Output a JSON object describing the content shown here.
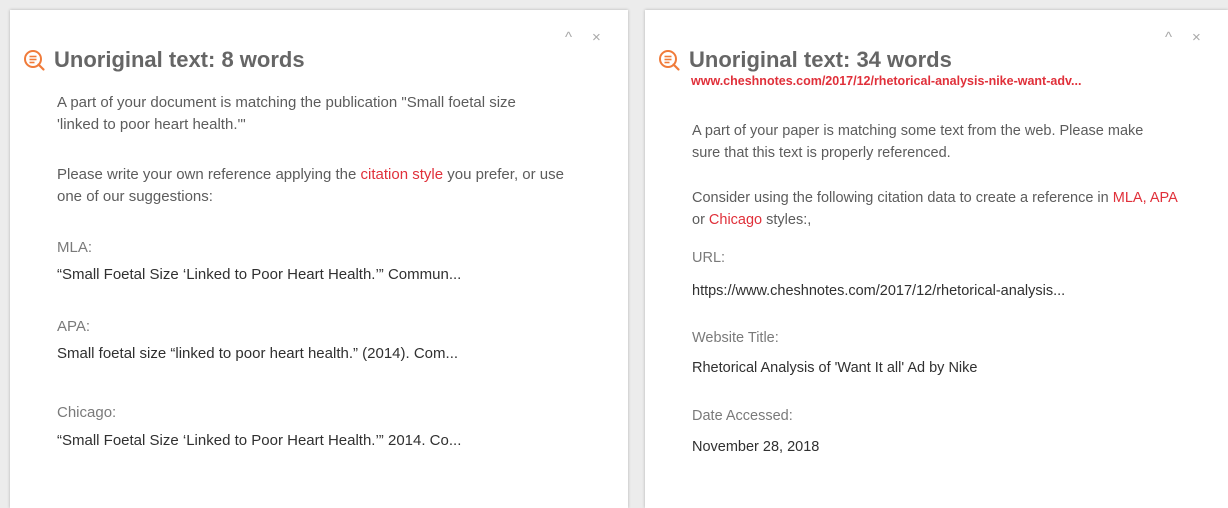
{
  "left_panel": {
    "title": "Unoriginal text: 8 words",
    "intro": "A part of your document is matching the publication \"Small foetal size 'linked to poor heart health.'\"",
    "instruction_before": "Please write your own reference applying the ",
    "instruction_link": "citation style",
    "instruction_after": " you prefer, or use one of our suggestions:",
    "citations": [
      {
        "label": "MLA:",
        "value": "“Small Foetal Size ‘Linked to Poor Heart Health.’” Commun..."
      },
      {
        "label": "APA:",
        "value": "Small foetal size “linked to poor heart health.” (2014). Com..."
      },
      {
        "label": "Chicago:",
        "value": "“Small Foetal Size ‘Linked to Poor Heart Health.’” 2014. Co..."
      }
    ]
  },
  "right_panel": {
    "title": "Unoriginal text: 34 words",
    "source_url": "www.cheshnotes.com/2017/12/rhetorical-analysis-nike-want-adv...",
    "intro": "A part of your paper is matching some text from the web. Please make sure that this text is properly referenced.",
    "consider_before": "Consider using the following citation data to create a reference in ",
    "link_mla_apa": "MLA, APA",
    "consider_or": " or ",
    "link_chicago": "Chicago",
    "consider_after": " styles:,",
    "fields": [
      {
        "label": "URL:",
        "value": "https://www.cheshnotes.com/2017/12/rhetorical-analysis..."
      },
      {
        "label": "Website Title:",
        "value": "Rhetorical Analysis of 'Want It all' Ad by Nike"
      },
      {
        "label": "Date Accessed:",
        "value": "November 28, 2018"
      }
    ]
  },
  "controls": {
    "collapse_glyph": "^",
    "close_glyph": "×"
  },
  "colors": {
    "accent": "#e0303a",
    "title": "#666666",
    "icon": "#f07b3a"
  }
}
